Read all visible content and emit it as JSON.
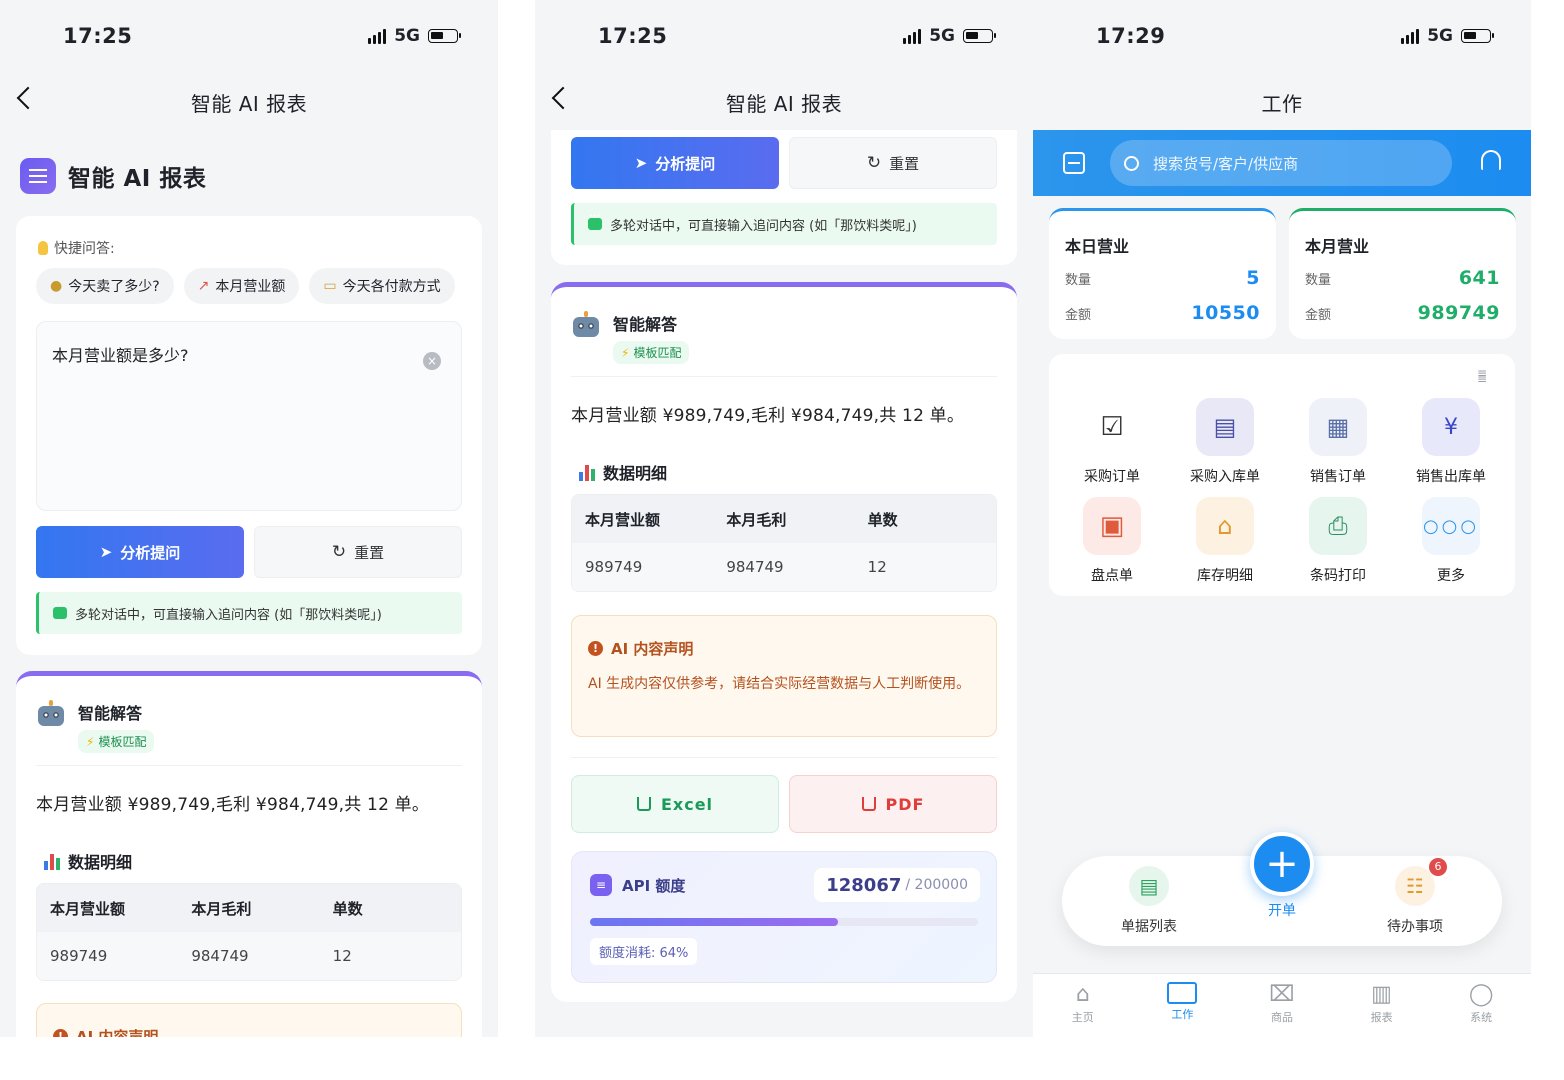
{
  "phone1": {
    "status": {
      "time": "17:25",
      "network": "5G"
    },
    "nav_title": "智能 AI 报表",
    "header_title": "智能 AI 报表",
    "quick_label": "快捷问答:",
    "quick_items": [
      {
        "icon": "money-bag-icon",
        "label": "今天卖了多少?"
      },
      {
        "icon": "chart-up-icon",
        "label": "本月营业额"
      },
      {
        "icon": "card-icon",
        "label": "今天各付款方式"
      }
    ],
    "query": "本月营业额是多少?",
    "analyze_label": "分析提问",
    "reset_label": "重置",
    "tip": "多轮对话中，可直接输入追问内容 (如「那饮料类呢」)",
    "answer_title": "智能解答",
    "template_badge": "模板匹配",
    "summary": "本月营业额 ¥989,749,毛利 ¥984,749,共 12 单。",
    "detail_title": "数据明细",
    "table": {
      "headers": [
        "本月营业额",
        "本月毛利",
        "单数"
      ],
      "rows": [
        [
          "989749",
          "984749",
          "12"
        ]
      ]
    },
    "disclaimer_title": "AI 内容声明"
  },
  "phone2": {
    "status": {
      "time": "17:25",
      "network": "5G"
    },
    "nav_title": "智能 AI 报表",
    "analyze_label": "分析提问",
    "reset_label": "重置",
    "tip": "多轮对话中，可直接输入追问内容 (如「那饮料类呢」)",
    "answer_title": "智能解答",
    "template_badge": "模板匹配",
    "summary": "本月营业额 ¥989,749,毛利 ¥984,749,共 12 单。",
    "detail_title": "数据明细",
    "table": {
      "headers": [
        "本月营业额",
        "本月毛利",
        "单数"
      ],
      "rows": [
        [
          "989749",
          "984749",
          "12"
        ]
      ]
    },
    "disclaimer_title": "AI 内容声明",
    "disclaimer_body": "AI 生成内容仅供参考，请结合实际经营数据与人工判断使用。",
    "excel_label": "Excel",
    "pdf_label": "PDF",
    "api_title": "API 额度",
    "api_used": "128067",
    "api_total": "/ 200000",
    "api_percent": 64,
    "api_consumed": "额度消耗: 64%"
  },
  "phone3": {
    "status": {
      "time": "17:29",
      "network": "5G"
    },
    "nav_title": "工作",
    "search_placeholder": "搜索货号/客户/供应商",
    "today": {
      "title": "本日营业",
      "qty_label": "数量",
      "qty": "5",
      "amt_label": "金额",
      "amt": "10550"
    },
    "month": {
      "title": "本月营业",
      "qty_label": "数量",
      "qty": "641",
      "amt_label": "金额",
      "amt": "989749"
    },
    "grid_items": [
      "采购订单",
      "采购入库单",
      "销售订单",
      "销售出库单",
      "盘点单",
      "库存明细",
      "条码打印",
      "更多"
    ],
    "dock": {
      "left": "单据列表",
      "center": "开单",
      "right": "待办事项",
      "badge": "6"
    },
    "tabs": [
      "主页",
      "工作",
      "商品",
      "报表",
      "系统"
    ],
    "active_tab": "工作"
  },
  "colors": {
    "primary": "#3377f0",
    "accent_purple": "#8a6cf0",
    "green": "#1fae6a",
    "blue_value": "#1c8cf0",
    "orange_warn": "#b4521f"
  }
}
